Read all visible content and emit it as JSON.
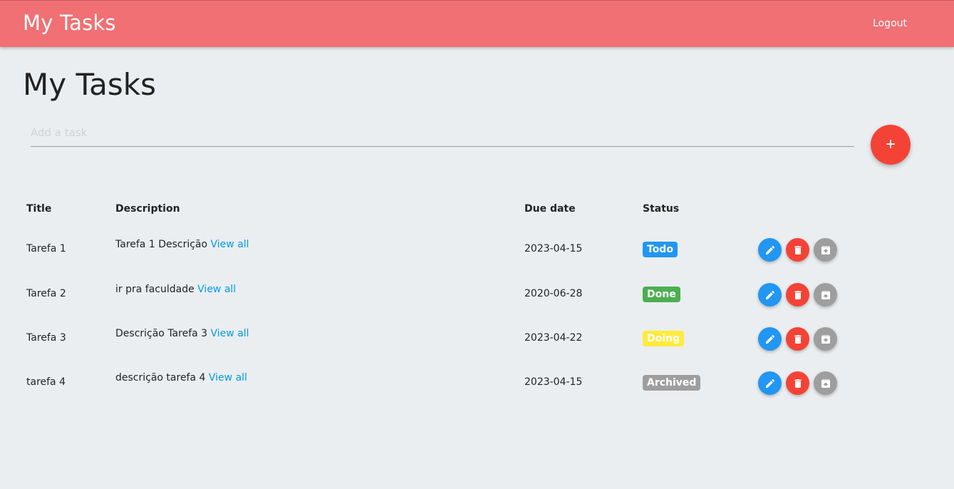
{
  "navbar": {
    "brand": "My Tasks",
    "logout_label": "Logout"
  },
  "page": {
    "title": "My Tasks"
  },
  "add_task": {
    "placeholder": "Add a task",
    "button_label": "+"
  },
  "table": {
    "headers": {
      "title": "Title",
      "description": "Description",
      "due_date": "Due date",
      "status": "Status"
    },
    "view_all_label": "View all",
    "rows": [
      {
        "title": "Tarefa 1",
        "description": "Tarefa 1 Descrição",
        "due_date": "2023-04-15",
        "status": "Todo",
        "status_color": "#2196f3"
      },
      {
        "title": "Tarefa 2",
        "description": "ir pra faculdade",
        "due_date": "2020-06-28",
        "status": "Done",
        "status_color": "#4caf50"
      },
      {
        "title": "Tarefa 3",
        "description": "Descrição Tarefa 3",
        "due_date": "2023-04-22",
        "status": "Doing",
        "status_color": "#ffeb3b"
      },
      {
        "title": "tarefa 4",
        "description": "descrição tarefa 4",
        "due_date": "2023-04-15",
        "status": "Archived",
        "status_color": "#9e9e9e"
      }
    ]
  },
  "icons": {
    "edit": "pencil-icon",
    "delete": "trash-icon",
    "archive": "archive-icon"
  },
  "colors": {
    "navbar": "#f07074",
    "background": "#eaeef1",
    "add_button": "#f44336",
    "link": "#039be5"
  }
}
